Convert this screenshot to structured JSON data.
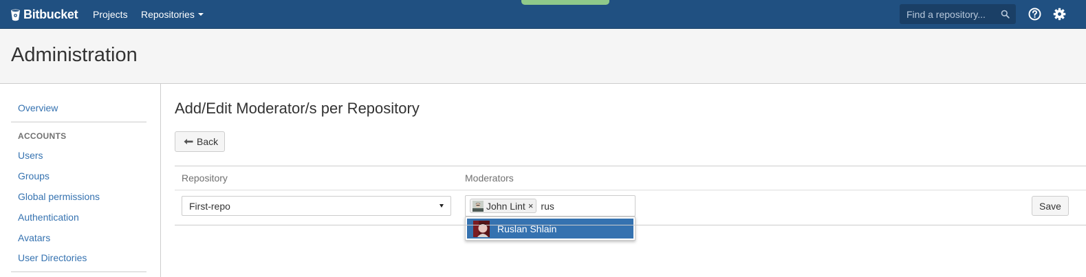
{
  "topbar": {
    "brand": "Bitbucket",
    "nav": [
      {
        "label": "Projects"
      },
      {
        "label": "Repositories"
      }
    ],
    "search_placeholder": "Find a repository...",
    "colors": {
      "bar": "#205081",
      "status_tab": "#8fc98a"
    }
  },
  "header": {
    "title": "Administration"
  },
  "sidebar": {
    "overview": "Overview",
    "section_heading": "ACCOUNTS",
    "items": [
      {
        "label": "Users"
      },
      {
        "label": "Groups"
      },
      {
        "label": "Global permissions"
      },
      {
        "label": "Authentication"
      },
      {
        "label": "Avatars"
      },
      {
        "label": "User Directories"
      }
    ]
  },
  "main": {
    "title": "Add/Edit Moderator/s per Repository",
    "back_label": "Back",
    "columns": {
      "repository": "Repository",
      "moderators": "Moderators"
    },
    "row": {
      "repository_value": "First-repo",
      "moderators": [
        {
          "name": "John Lint",
          "remove": "×"
        }
      ],
      "moderator_query": "rus",
      "suggestion": "Ruslan Shlain",
      "save_label": "Save"
    },
    "colors": {
      "link": "#3572b0",
      "highlight": "#3572b0"
    }
  },
  "icons": {
    "logo": "bitbucket-bucket-icon",
    "search": "search-icon",
    "help": "question-circle-icon",
    "settings": "gear-icon",
    "back": "arrow-left-icon",
    "select": "caret-down-icon"
  }
}
